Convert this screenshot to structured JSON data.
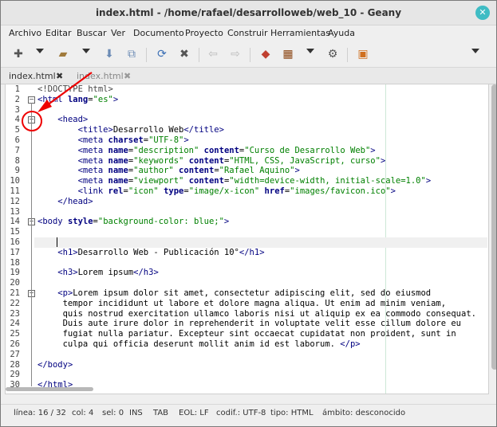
{
  "window": {
    "title": "index.html - /home/rafael/desarrolloweb/web_10 - Geany"
  },
  "menu": [
    "Archivo",
    "Editar",
    "Buscar",
    "Ver",
    "Documento",
    "Proyecto",
    "Construir",
    "Herramientas",
    "Ayuda"
  ],
  "tabs": [
    {
      "label": "index.html",
      "active": true
    },
    {
      "label": "index.html",
      "active": false
    }
  ],
  "editor": {
    "lines": [
      [
        "<!DOCTYPE html>"
      ],
      [
        "<html lang=\"es\">"
      ],
      [
        ""
      ],
      [
        "    <head>"
      ],
      [
        "        <title>Desarrollo Web</title>"
      ],
      [
        "        <meta charset=\"UTF-8\">"
      ],
      [
        "        <meta name=\"description\" content=\"Curso de Desarrollo Web\">"
      ],
      [
        "        <meta name=\"keywords\" content=\"HTML, CSS, JavaScript, curso\">"
      ],
      [
        "        <meta name=\"author\" content=\"Rafael Aquino\">"
      ],
      [
        "        <meta name=\"viewport\" content=\"width=device-width, initial-scale=1.0\">"
      ],
      [
        "        <link rel=\"icon\" type=\"image/x-icon\" href=\"images/favicon.ico\">"
      ],
      [
        "    </head>"
      ],
      [
        ""
      ],
      [
        "<body style=\"background-color: blue;\">"
      ],
      [
        ""
      ],
      [
        "    "
      ],
      [
        "    <h1>Desarrollo Web - Publicación 10°</h1>"
      ],
      [
        ""
      ],
      [
        "    <h3>Lorem ipsum</h3>"
      ],
      [
        ""
      ],
      [
        "    <p>Lorem ipsum dolor sit amet, consectetur adipiscing elit, sed do eiusmod"
      ],
      [
        "     tempor incididunt ut labore et dolore magna aliqua. Ut enim ad minim veniam,"
      ],
      [
        "     quis nostrud exercitation ullamco laboris nisi ut aliquip ex ea commodo consequat."
      ],
      [
        "     Duis aute irure dolor in reprehenderit in voluptate velit esse cillum dolore eu"
      ],
      [
        "     fugiat nulla pariatur. Excepteur sint occaecat cupidatat non proident, sunt in"
      ],
      [
        "     culpa qui officia deserunt mollit anim id est laborum. </p>"
      ],
      [
        ""
      ],
      [
        "</body>"
      ],
      [
        ""
      ],
      [
        "</html>"
      ]
    ],
    "line_numbers": [
      "1",
      "2",
      "3",
      "4",
      "5",
      "6",
      "7",
      "8",
      "9",
      "10",
      "11",
      "12",
      "13",
      "14",
      "15",
      "16",
      "17",
      "18",
      "19",
      "20",
      "21",
      "22",
      "23",
      "24",
      "25",
      "26",
      "27",
      "28",
      "29",
      "30"
    ]
  },
  "status": {
    "linea": "línea: 16 / 32",
    "col": "col: 4",
    "sel": "sel: 0",
    "ins": "INS",
    "tab": "TAB",
    "eol": "EOL: LF",
    "codif": "codif.: UTF-8",
    "tipo": "tipo: HTML",
    "ambito": "ámbito: desconocido"
  },
  "colors": {
    "tag": "#000080",
    "value": "#008000",
    "annotation": "#e00000",
    "close_button": "#3fbcc4"
  }
}
